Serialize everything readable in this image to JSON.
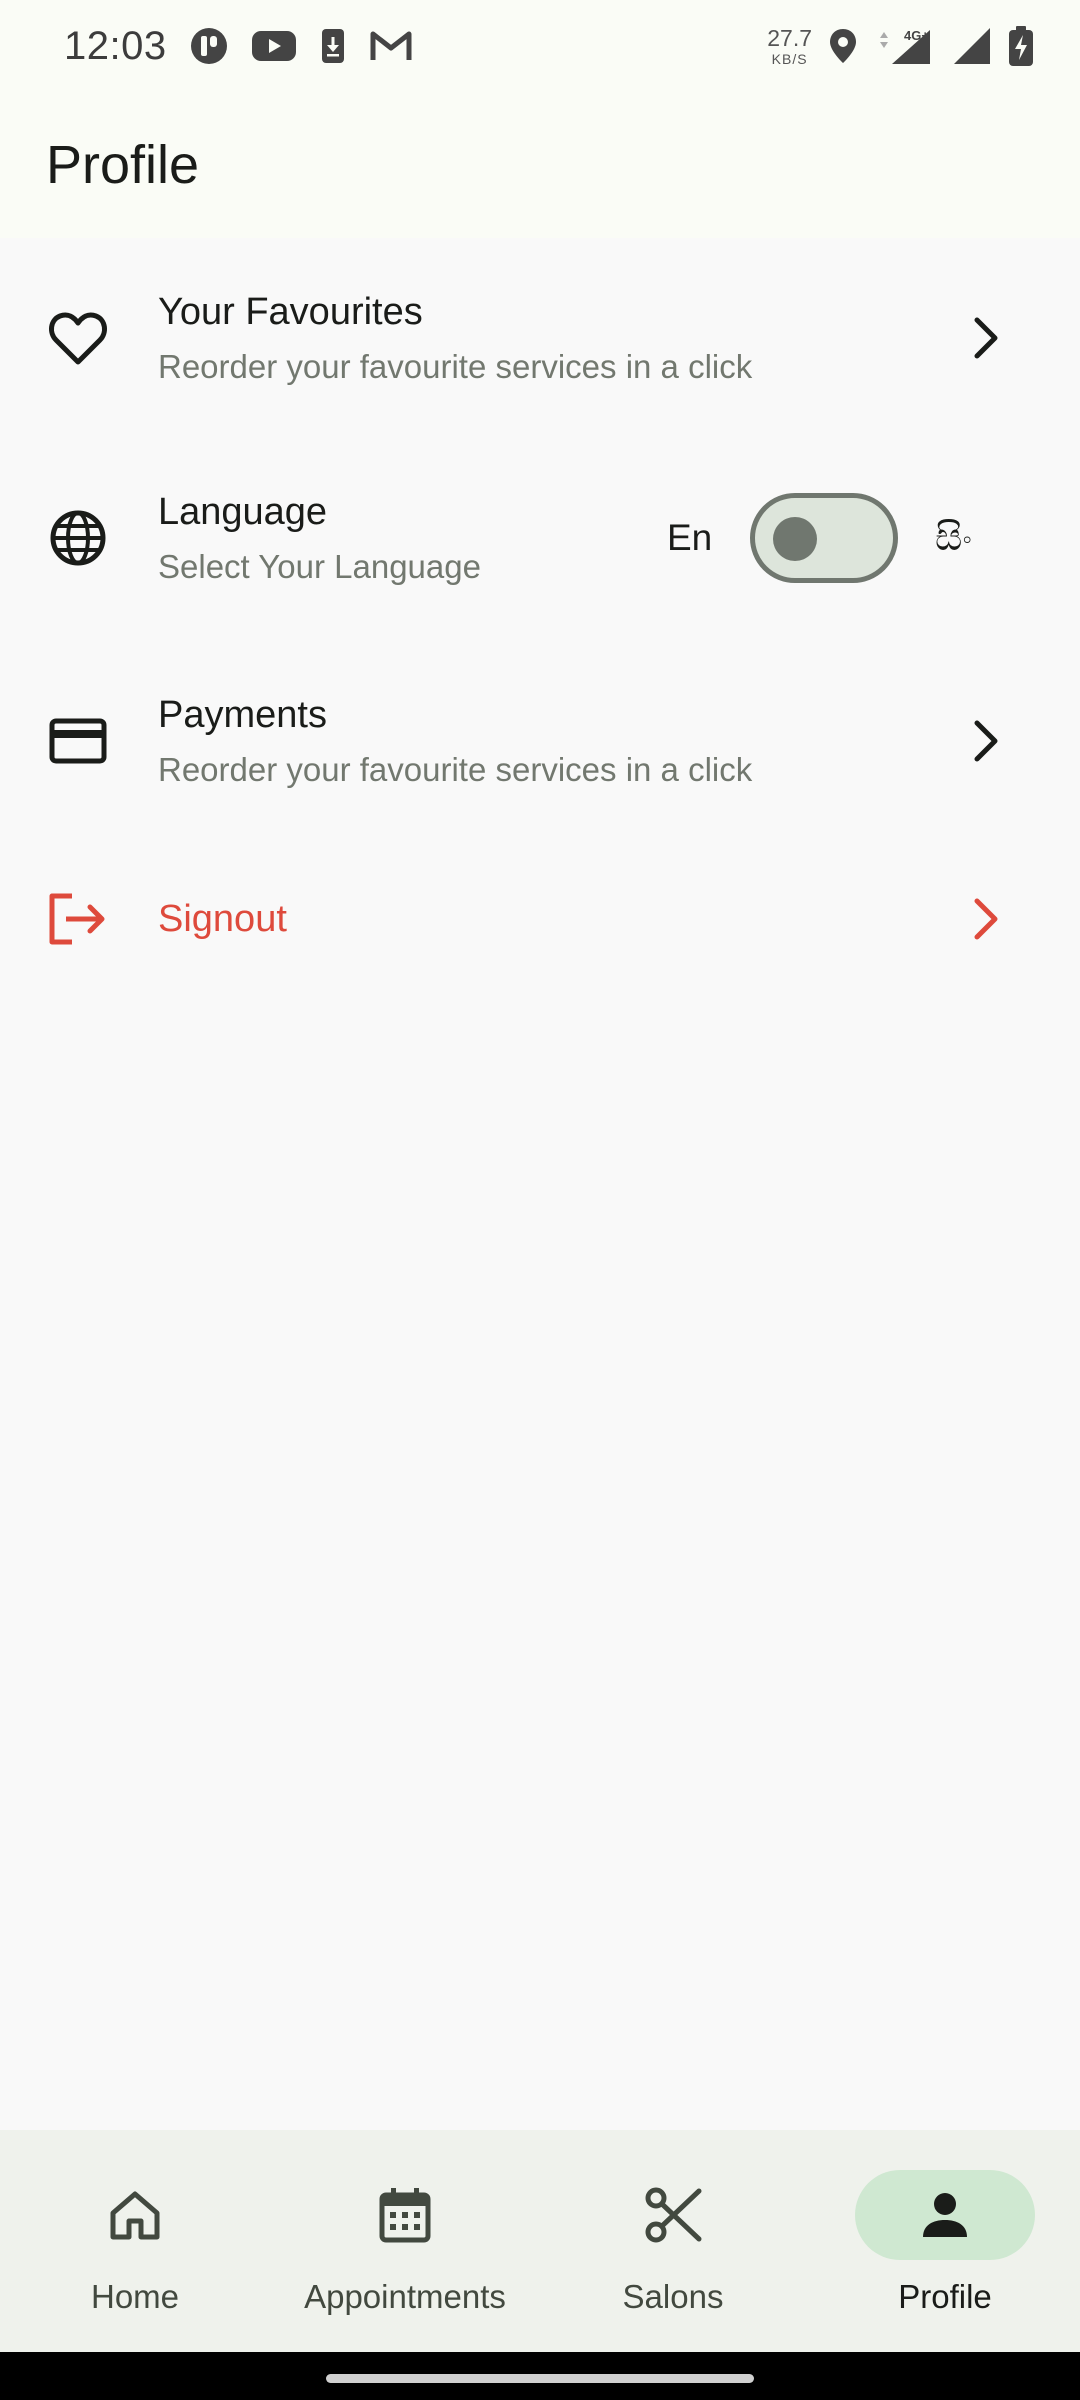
{
  "status_bar": {
    "time": "12:03",
    "net_speed_value": "27.7",
    "net_speed_unit": "KB/S",
    "network_label": "4G+"
  },
  "app_bar": {
    "title": "Profile"
  },
  "menu": {
    "favourites": {
      "title": "Your Favourites",
      "subtitle": "Reorder your favourite services in a click",
      "icon": "heart-outline-icon"
    },
    "language": {
      "title": "Language",
      "subtitle": "Select Your Language",
      "option_left": "En",
      "option_right": "සිං",
      "toggle_on": false,
      "icon": "globe-icon"
    },
    "payments": {
      "title": "Payments",
      "subtitle": "Reorder your favourite services in a click",
      "icon": "credit-card-icon"
    },
    "signout": {
      "title": "Signout",
      "icon": "logout-icon",
      "color": "#de4a3c"
    }
  },
  "bottom_nav": {
    "items": [
      {
        "label": "Home",
        "icon": "home-icon",
        "active": false
      },
      {
        "label": "Appointments",
        "icon": "calendar-icon",
        "active": false
      },
      {
        "label": "Salons",
        "icon": "scissors-icon",
        "active": false
      },
      {
        "label": "Profile",
        "icon": "person-icon",
        "active": true
      }
    ],
    "active_color": "#cfe8d1"
  }
}
